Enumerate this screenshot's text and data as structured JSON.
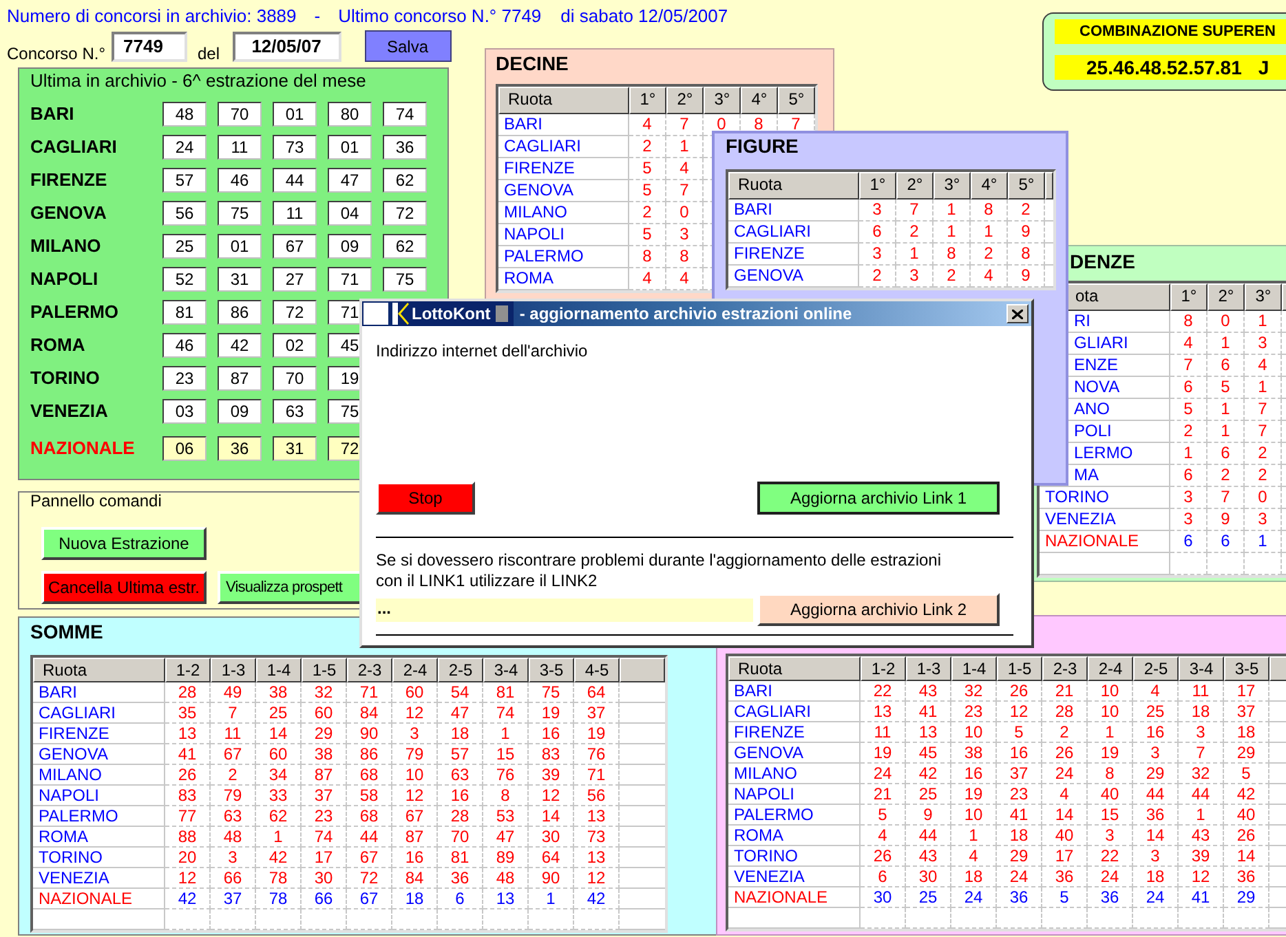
{
  "header": {
    "archive_count": "Numero di concorsi in archivio: 3889",
    "separator": "-",
    "last_draw": "Ultimo concorso N.° 7749",
    "date": "di sabato 12/05/2007"
  },
  "draw_form": {
    "number_label": "Concorso N.°",
    "number": "7749",
    "date_label": "del",
    "date": "12/05/07",
    "save_button": "Salva"
  },
  "last_draw_panel": {
    "title": "Ultima in archivio - 6^ estrazione del mese",
    "rows": [
      {
        "wheel": "BARI",
        "kind": "ruota",
        "numbers": [
          "48",
          "70",
          "01",
          "80",
          "74"
        ]
      },
      {
        "wheel": "CAGLIARI",
        "kind": "ruota",
        "numbers": [
          "24",
          "11",
          "73",
          "01",
          "36"
        ]
      },
      {
        "wheel": "FIRENZE",
        "kind": "ruota",
        "numbers": [
          "57",
          "46",
          "44",
          "47",
          "62"
        ]
      },
      {
        "wheel": "GENOVA",
        "kind": "ruota",
        "numbers": [
          "56",
          "75",
          "11",
          "04",
          "72"
        ]
      },
      {
        "wheel": "MILANO",
        "kind": "ruota",
        "numbers": [
          "25",
          "01",
          "67",
          "09",
          "62"
        ]
      },
      {
        "wheel": "NAPOLI",
        "kind": "ruota",
        "numbers": [
          "52",
          "31",
          "27",
          "71",
          "75"
        ]
      },
      {
        "wheel": "PALERMO",
        "kind": "ruota",
        "numbers": [
          "81",
          "86",
          "72",
          "71"
        ]
      },
      {
        "wheel": "ROMA",
        "kind": "ruota",
        "numbers": [
          "46",
          "42",
          "02",
          "45"
        ]
      },
      {
        "wheel": "TORINO",
        "kind": "ruota",
        "numbers": [
          "23",
          "87",
          "70",
          "19"
        ]
      },
      {
        "wheel": "VENEZIA",
        "kind": "ruota",
        "numbers": [
          "03",
          "09",
          "63",
          "75"
        ]
      },
      {
        "wheel": "NAZIONALE",
        "kind": "nazionale",
        "numbers": [
          "06",
          "36",
          "31",
          "72"
        ]
      }
    ]
  },
  "decine": {
    "title": "DECINE",
    "columns": [
      "Ruota",
      "1°",
      "2°",
      "3°",
      "4°",
      "5°"
    ],
    "rows": [
      {
        "wheel": "BARI",
        "kind": "ruota",
        "values": [
          "4",
          "7",
          "0",
          "8",
          "7"
        ]
      },
      {
        "wheel": "CAGLIARI",
        "kind": "ruota",
        "values": [
          "2",
          "1"
        ]
      },
      {
        "wheel": "FIRENZE",
        "kind": "ruota",
        "values": [
          "5",
          "4"
        ]
      },
      {
        "wheel": "GENOVA",
        "kind": "ruota",
        "values": [
          "5",
          "7"
        ]
      },
      {
        "wheel": "MILANO",
        "kind": "ruota",
        "values": [
          "2",
          "0"
        ]
      },
      {
        "wheel": "NAPOLI",
        "kind": "ruota",
        "values": [
          "5",
          "3"
        ]
      },
      {
        "wheel": "PALERMO",
        "kind": "ruota",
        "values": [
          "8",
          "8"
        ]
      },
      {
        "wheel": "ROMA",
        "kind": "ruota",
        "values": [
          "4",
          "4"
        ]
      }
    ]
  },
  "figure": {
    "title": "FIGURE",
    "columns": [
      "Ruota",
      "1°",
      "2°",
      "3°",
      "4°",
      "5°"
    ],
    "rows": [
      {
        "wheel": "BARI",
        "kind": "ruota",
        "values": [
          "3",
          "7",
          "1",
          "8",
          "2"
        ]
      },
      {
        "wheel": "CAGLIARI",
        "kind": "ruota",
        "values": [
          "6",
          "2",
          "1",
          "1",
          "9"
        ]
      },
      {
        "wheel": "FIRENZE",
        "kind": "ruota",
        "values": [
          "3",
          "1",
          "8",
          "2",
          "8"
        ]
      },
      {
        "wheel": "GENOVA",
        "kind": "ruota",
        "values": [
          "2",
          "3",
          "2",
          "4",
          "9"
        ]
      }
    ]
  },
  "cadenze": {
    "title": "DENZE",
    "columns": [
      "ota",
      "1°",
      "2°",
      "3°"
    ],
    "rows": [
      {
        "wheel": "RI",
        "kind": "ruota",
        "values": [
          "8",
          "0",
          "1"
        ]
      },
      {
        "wheel": "GLIARI",
        "kind": "ruota",
        "values": [
          "4",
          "1",
          "3"
        ]
      },
      {
        "wheel": "ENZE",
        "kind": "ruota",
        "values": [
          "7",
          "6",
          "4"
        ]
      },
      {
        "wheel": "NOVA",
        "kind": "ruota",
        "values": [
          "6",
          "5",
          "1"
        ]
      },
      {
        "wheel": "ANO",
        "kind": "ruota",
        "values": [
          "5",
          "1",
          "7"
        ]
      },
      {
        "wheel": "POLI",
        "kind": "ruota",
        "values": [
          "2",
          "1",
          "7"
        ]
      },
      {
        "wheel": "LERMO",
        "kind": "ruota",
        "values": [
          "1",
          "6",
          "2"
        ]
      },
      {
        "wheel": "MA",
        "kind": "ruota",
        "values": [
          "6",
          "2",
          "2"
        ]
      },
      {
        "wheel": "TORINO",
        "kind": "ruota",
        "values": [
          "3",
          "7",
          "0"
        ]
      },
      {
        "wheel": "VENEZIA",
        "kind": "ruota",
        "values": [
          "3",
          "9",
          "3"
        ]
      },
      {
        "wheel": "NAZIONALE",
        "kind": "nazionale",
        "values": [
          "6",
          "6",
          "1"
        ]
      }
    ]
  },
  "superenalotto": {
    "title": "COMBINAZIONE SUPEREN",
    "combination": "25.46.48.52.57.81",
    "jolly": "J"
  },
  "command_panel": {
    "title": "Pannello comandi",
    "buttons": [
      {
        "label": "Nuova Estrazione",
        "color": "#80ff80"
      },
      {
        "label": "Cancella Ultima estr.",
        "color": "#ff0000"
      },
      {
        "label": "Visualizza prospett",
        "color": "#80ff80"
      }
    ]
  },
  "somme": {
    "title": "SOMME",
    "columns": [
      "Ruota",
      "1-2",
      "1-3",
      "1-4",
      "1-5",
      "2-3",
      "2-4",
      "2-5",
      "3-4",
      "3-5",
      "4-5"
    ],
    "rows": [
      {
        "wheel": "BARI",
        "kind": "ruota",
        "values": [
          "28",
          "49",
          "38",
          "32",
          "71",
          "60",
          "54",
          "81",
          "75",
          "64"
        ]
      },
      {
        "wheel": "CAGLIARI",
        "kind": "ruota",
        "values": [
          "35",
          "7",
          "25",
          "60",
          "84",
          "12",
          "47",
          "74",
          "19",
          "37"
        ]
      },
      {
        "wheel": "FIRENZE",
        "kind": "ruota",
        "values": [
          "13",
          "11",
          "14",
          "29",
          "90",
          "3",
          "18",
          "1",
          "16",
          "19"
        ]
      },
      {
        "wheel": "GENOVA",
        "kind": "ruota",
        "values": [
          "41",
          "67",
          "60",
          "38",
          "86",
          "79",
          "57",
          "15",
          "83",
          "76"
        ]
      },
      {
        "wheel": "MILANO",
        "kind": "ruota",
        "values": [
          "26",
          "2",
          "34",
          "87",
          "68",
          "10",
          "63",
          "76",
          "39",
          "71"
        ]
      },
      {
        "wheel": "NAPOLI",
        "kind": "ruota",
        "values": [
          "83",
          "79",
          "33",
          "37",
          "58",
          "12",
          "16",
          "8",
          "12",
          "56"
        ]
      },
      {
        "wheel": "PALERMO",
        "kind": "ruota",
        "values": [
          "77",
          "63",
          "62",
          "23",
          "68",
          "67",
          "28",
          "53",
          "14",
          "13"
        ]
      },
      {
        "wheel": "ROMA",
        "kind": "ruota",
        "values": [
          "88",
          "48",
          "1",
          "74",
          "44",
          "87",
          "70",
          "47",
          "30",
          "73"
        ]
      },
      {
        "wheel": "TORINO",
        "kind": "ruota",
        "values": [
          "20",
          "3",
          "42",
          "17",
          "67",
          "16",
          "81",
          "89",
          "64",
          "13"
        ]
      },
      {
        "wheel": "VENEZIA",
        "kind": "ruota",
        "values": [
          "12",
          "66",
          "78",
          "30",
          "72",
          "84",
          "36",
          "48",
          "90",
          "12"
        ]
      },
      {
        "wheel": "NAZIONALE",
        "kind": "nazionale",
        "values": [
          "42",
          "37",
          "78",
          "66",
          "67",
          "18",
          "6",
          "13",
          "1",
          "42"
        ]
      }
    ]
  },
  "second_table": {
    "columns": [
      "Ruota",
      "1-2",
      "1-3",
      "1-4",
      "1-5",
      "2-3",
      "2-4",
      "2-5",
      "3-4",
      "3-5"
    ],
    "rows": [
      {
        "wheel": "BARI",
        "kind": "ruota",
        "values": [
          "22",
          "43",
          "32",
          "26",
          "21",
          "10",
          "4",
          "11",
          "17"
        ]
      },
      {
        "wheel": "CAGLIARI",
        "kind": "ruota",
        "values": [
          "13",
          "41",
          "23",
          "12",
          "28",
          "10",
          "25",
          "18",
          "37"
        ]
      },
      {
        "wheel": "FIRENZE",
        "kind": "ruota",
        "values": [
          "11",
          "13",
          "10",
          "5",
          "2",
          "1",
          "16",
          "3",
          "18"
        ]
      },
      {
        "wheel": "GENOVA",
        "kind": "ruota",
        "values": [
          "19",
          "45",
          "38",
          "16",
          "26",
          "19",
          "3",
          "7",
          "29"
        ]
      },
      {
        "wheel": "MILANO",
        "kind": "ruota",
        "values": [
          "24",
          "42",
          "16",
          "37",
          "24",
          "8",
          "29",
          "32",
          "5"
        ]
      },
      {
        "wheel": "NAPOLI",
        "kind": "ruota",
        "values": [
          "21",
          "25",
          "19",
          "23",
          "4",
          "40",
          "44",
          "44",
          "42"
        ]
      },
      {
        "wheel": "PALERMO",
        "kind": "ruota",
        "values": [
          "5",
          "9",
          "10",
          "41",
          "14",
          "15",
          "36",
          "1",
          "40"
        ]
      },
      {
        "wheel": "ROMA",
        "kind": "ruota",
        "values": [
          "4",
          "44",
          "1",
          "18",
          "40",
          "3",
          "14",
          "43",
          "26"
        ]
      },
      {
        "wheel": "TORINO",
        "kind": "ruota",
        "values": [
          "26",
          "43",
          "4",
          "29",
          "17",
          "22",
          "3",
          "39",
          "14"
        ]
      },
      {
        "wheel": "VENEZIA",
        "kind": "ruota",
        "values": [
          "6",
          "30",
          "18",
          "24",
          "36",
          "24",
          "18",
          "12",
          "36"
        ]
      },
      {
        "wheel": "NAZIONALE",
        "kind": "nazionale",
        "values": [
          "30",
          "25",
          "24",
          "36",
          "5",
          "36",
          "24",
          "41",
          "29"
        ]
      }
    ]
  },
  "dialog": {
    "app_name": "LottoKont",
    "title": "- aggiornamento archivio estrazioni online",
    "address_label": "Indirizzo internet dell'archivio",
    "stop_button": {
      "label": "Stop",
      "color": "#ff0000"
    },
    "link1_button": {
      "label": "Aggiorna archivio Link 1",
      "color": "#80ff80"
    },
    "help_text": "Se si dovessero riscontrare problemi durante l'aggiornamento delle estrazioni con il LINK1 utilizzare il LINK2",
    "status": "...",
    "link2_button": {
      "label": "Aggiorna archivio Link 2",
      "color": "#ffd8c0"
    }
  }
}
